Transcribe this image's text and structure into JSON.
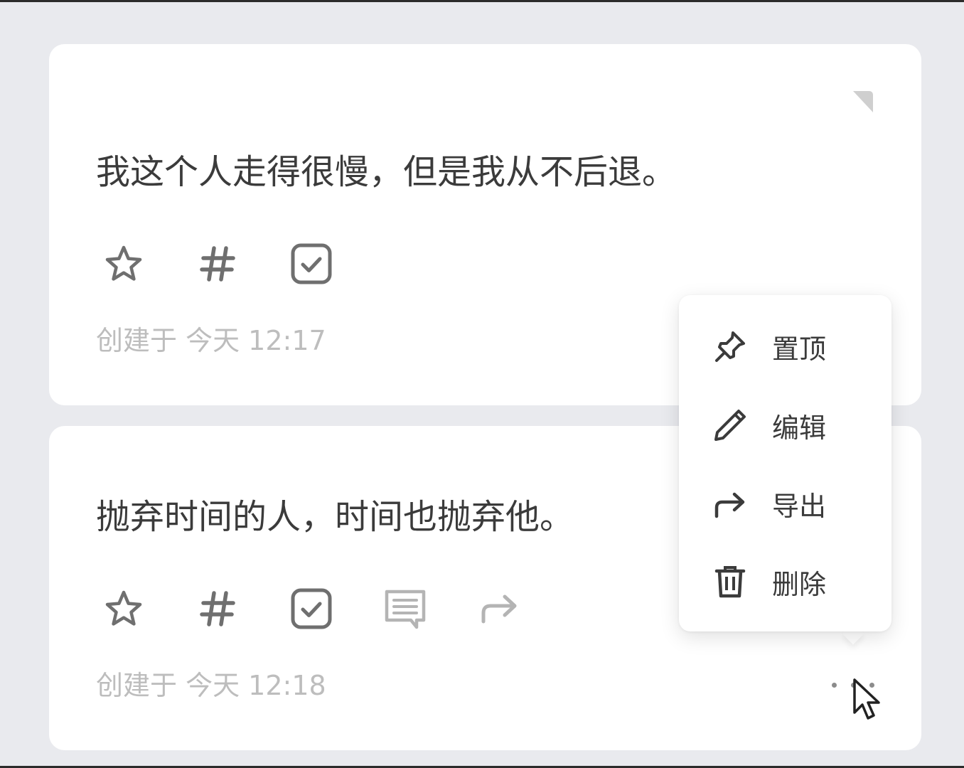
{
  "notes": [
    {
      "text": "我这个人走得很慢，但是我从不后退。",
      "created": "创建于 今天 12:17",
      "actions": [
        "star-icon",
        "hashtag-icon",
        "checkbox-icon"
      ]
    },
    {
      "text": "抛弃时间的人，时间也抛弃他。",
      "created": "创建于 今天 12:18",
      "actions": [
        "star-icon",
        "hashtag-icon",
        "checkbox-icon",
        "comment-icon",
        "share-icon"
      ]
    }
  ],
  "context_menu": {
    "items": [
      {
        "label": "置顶",
        "icon": "pin-icon"
      },
      {
        "label": "编辑",
        "icon": "pencil-icon"
      },
      {
        "label": "导出",
        "icon": "export-arrow-icon"
      },
      {
        "label": "删除",
        "icon": "trash-icon"
      }
    ]
  },
  "colors": {
    "background": "#e9eaee",
    "card": "#ffffff",
    "text": "#3b3b3b",
    "muted": "#bdbdbd",
    "icon": "#6f6f6f"
  }
}
